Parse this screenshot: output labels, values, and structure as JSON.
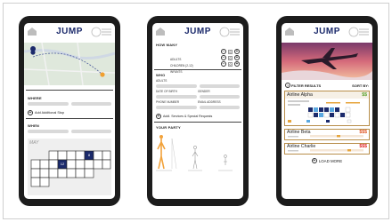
{
  "app": {
    "logo": "JUMP"
  },
  "screen1": {
    "where_label": "WHERE",
    "add_stop": "Add Additional Stop",
    "when_label": "WHEN",
    "month": "MAY",
    "day_a": "12",
    "day_b": "8"
  },
  "screen2": {
    "how_many": "HOW MANY",
    "travelers": [
      {
        "label": "ADULTS",
        "value": "0"
      },
      {
        "label": "CHILDREN (2-12)",
        "value": "0"
      },
      {
        "label": "INFANTS",
        "value": "0"
      }
    ],
    "who": "WHO",
    "adults": "ADULTS",
    "dob": "DATE OF BIRTH",
    "gender": "GENDER",
    "phone": "PHONE NUMBER",
    "email": "EMAIL ADDRESS",
    "addl": "Addl. Services & Special Requests",
    "party": "YOUR PARTY"
  },
  "screen3": {
    "filter": "FILTER RESULTS",
    "sort": "SORT BY:",
    "results": [
      {
        "name": "Airline Alpha",
        "price": "$$",
        "price_color": "#5aa02c"
      },
      {
        "name": "Airline Beta",
        "price": "$$$",
        "price_color": "#e05a2a"
      },
      {
        "name": "Airline Charlie",
        "price": "$$$",
        "price_color": "#e02a2a"
      }
    ],
    "load_more": "LOAD MORE"
  }
}
